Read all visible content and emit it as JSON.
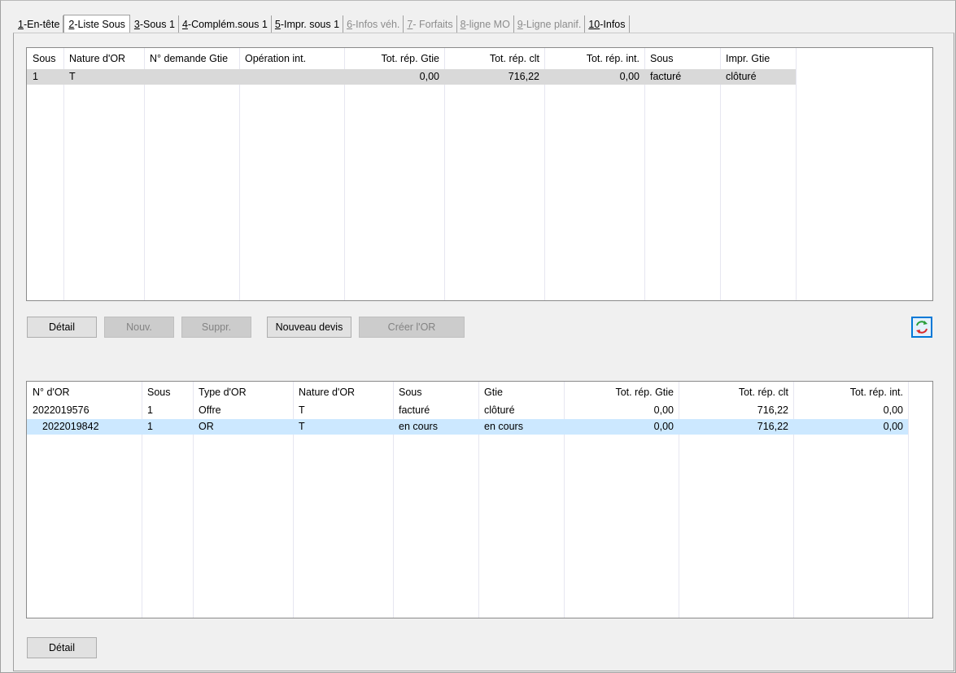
{
  "tabs": [
    {
      "key": "1",
      "rest": "-En-tête",
      "state": "normal"
    },
    {
      "key": "2",
      "rest": "-Liste Sous",
      "state": "active"
    },
    {
      "key": "3",
      "rest": "-Sous 1",
      "state": "normal"
    },
    {
      "key": "4",
      "rest": "-Complém.sous 1",
      "state": "normal"
    },
    {
      "key": "5",
      "rest": "-Impr. sous 1",
      "state": "normal"
    },
    {
      "key": "6",
      "rest": "-Infos véh.",
      "state": "disabled"
    },
    {
      "key": "7",
      "rest": "- Forfaits",
      "state": "disabled"
    },
    {
      "key": "8",
      "rest": "-ligne MO",
      "state": "disabled"
    },
    {
      "key": "9",
      "rest": "-Ligne planif.",
      "state": "disabled"
    },
    {
      "key": "10",
      "rest": "-Infos",
      "state": "normal"
    }
  ],
  "top_grid": {
    "headers": [
      "Sous",
      "Nature d'OR",
      "N° demande Gtie",
      "Opération int.",
      "Tot. rép. Gtie",
      "Tot. rép. clt",
      "Tot. rép. int.",
      "Sous",
      "Impr. Gtie"
    ],
    "rows": [
      [
        "1",
        "T",
        "",
        "",
        "0,00",
        "716,22",
        "0,00",
        "facturé",
        "clôturé"
      ]
    ]
  },
  "top_buttons": {
    "detail": "Détail",
    "nouv": "Nouv.",
    "suppr": "Suppr.",
    "nouveau_devis": "Nouveau devis",
    "creer_or": "Créer l'OR"
  },
  "bottom_grid": {
    "headers": [
      "N° d'OR",
      "Sous",
      "Type d'OR",
      "Nature d'OR",
      "Sous",
      "Gtie",
      "Tot. rép. Gtie",
      "Tot. rép. clt",
      "Tot. rép. int."
    ],
    "rows": [
      [
        "2022019576",
        "1",
        "Offre",
        "T",
        "facturé",
        "clôturé",
        "0,00",
        "716,22",
        "0,00"
      ],
      [
        "2022019842",
        "1",
        "OR",
        "T",
        "en cours",
        "en cours",
        "0,00",
        "716,22",
        "0,00"
      ]
    ]
  },
  "bottom_buttons": {
    "detail": "Détail"
  },
  "icons": {
    "refresh": "refresh-arrows-icon"
  },
  "colors": {
    "selected_row_grey": "#d9d9d9",
    "selected_row_blue": "#cce8ff",
    "focus_border": "#0078d7"
  }
}
